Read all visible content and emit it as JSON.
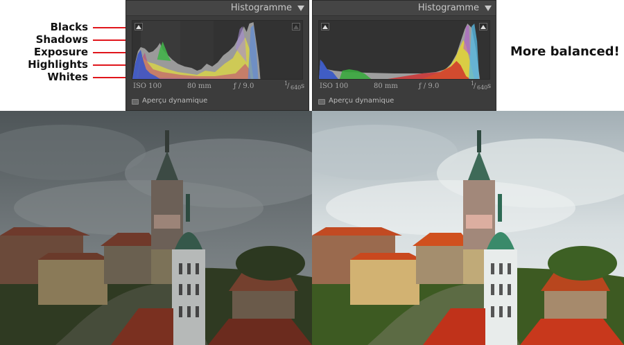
{
  "annotations": {
    "labels": [
      "Blacks",
      "Shadows",
      "Exposure",
      "Highlights",
      "Whites"
    ],
    "callout": "More balanced!"
  },
  "panels": [
    {
      "title": "Histogramme",
      "iso": "ISO 100",
      "focal": "80 mm",
      "aperture": "ƒ / 9.0",
      "shutter_num": "1",
      "shutter_den": "640",
      "shutter_unit": "s",
      "preview_label": "Aperçu dynamique"
    },
    {
      "title": "Histogramme",
      "iso": "ISO 100",
      "focal": "80 mm",
      "aperture": "ƒ / 9.0",
      "shutter_num": "1",
      "shutter_den": "640",
      "shutter_unit": "s",
      "preview_label": "Aperçu dynamique"
    }
  ],
  "colors": {
    "arrow": "#e0151b",
    "panel_bg": "#3c3c3c",
    "hist_bg": "#323232"
  },
  "photos": [
    "before-photo",
    "after-photo"
  ]
}
